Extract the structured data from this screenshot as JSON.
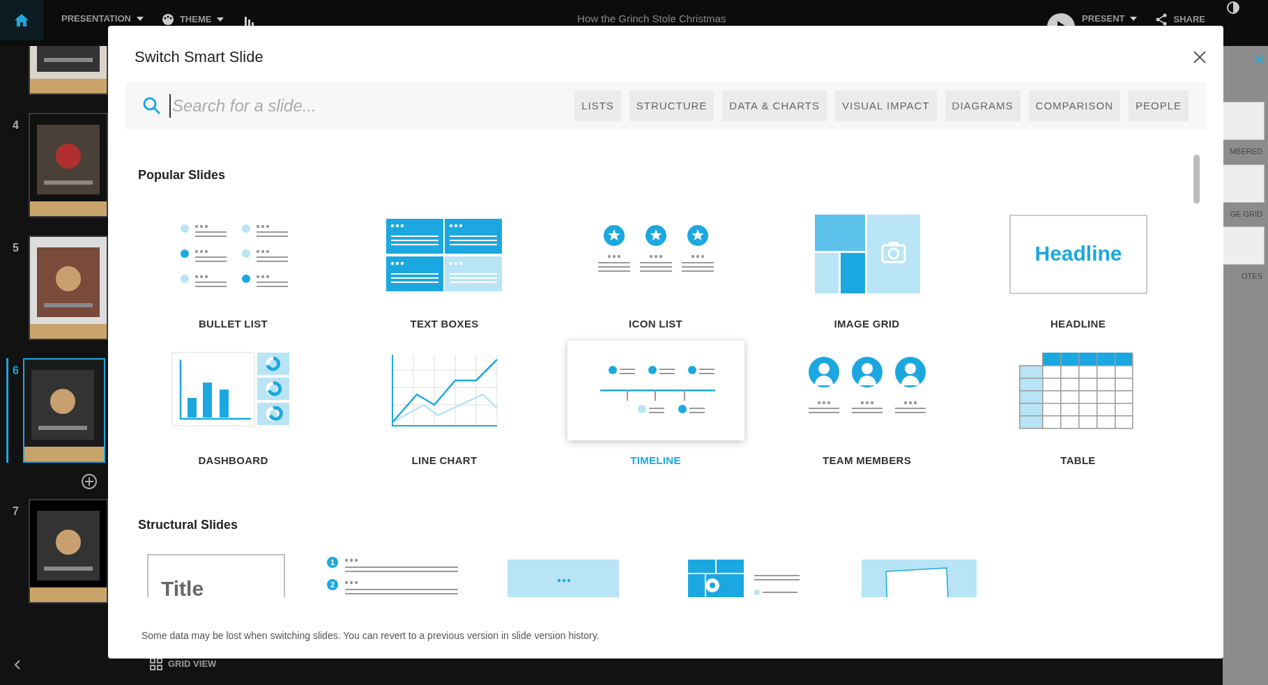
{
  "app": {
    "menus": [
      {
        "label": "PRESENTATION",
        "kind": "dropdown"
      },
      {
        "label": "THEME",
        "kind": "theme"
      }
    ],
    "title": "How the Grinch Stole Christmas",
    "present": "PRESENT",
    "share": "SHARE",
    "slides": [
      {
        "selected": false
      },
      {
        "number": "4",
        "selected": false
      },
      {
        "number": "5",
        "selected": false
      },
      {
        "number": "6",
        "selected": true
      },
      {
        "number": "7",
        "selected": false
      }
    ],
    "grid_view": "GRID VIEW",
    "panel_labels": [
      "MBERED",
      "GE GRID",
      "OTES"
    ]
  },
  "modal": {
    "title": "Switch Smart Slide",
    "search": {
      "placeholder": "Search for a slide..."
    },
    "categories": [
      "LISTS",
      "STRUCTURE",
      "DATA & CHARTS",
      "VISUAL IMPACT",
      "DIAGRAMS",
      "COMPARISON",
      "PEOPLE"
    ],
    "sections": [
      {
        "title": "Popular Slides",
        "items": [
          {
            "label": "BULLET LIST",
            "kind": "bullet",
            "selected": false
          },
          {
            "label": "TEXT BOXES",
            "kind": "textboxes",
            "selected": false
          },
          {
            "label": "ICON LIST",
            "kind": "iconlist",
            "selected": false
          },
          {
            "label": "IMAGE GRID",
            "kind": "imagegrid",
            "selected": false
          },
          {
            "label": "HEADLINE",
            "kind": "headline",
            "selected": false,
            "texts": [
              "Headline"
            ]
          },
          {
            "label": "DASHBOARD",
            "kind": "dashboard",
            "selected": false
          },
          {
            "label": "LINE CHART",
            "kind": "linechart",
            "selected": false
          },
          {
            "label": "TIMELINE",
            "kind": "timeline",
            "selected": true
          },
          {
            "label": "TEAM MEMBERS",
            "kind": "team",
            "selected": false
          },
          {
            "label": "TABLE",
            "kind": "table",
            "selected": false
          }
        ]
      },
      {
        "title": "Structural Slides",
        "items": [
          {
            "kind": "title",
            "selected": false,
            "texts": [
              "Title"
            ]
          },
          {
            "kind": "numbered",
            "selected": false,
            "texts": [
              "1",
              "2"
            ]
          },
          {
            "kind": "section",
            "selected": false
          },
          {
            "kind": "imagelist",
            "selected": false
          },
          {
            "kind": "tbd",
            "selected": false
          }
        ]
      }
    ],
    "note": "Some data may be lost when switching slides. You can revert to a previous version in slide version history."
  }
}
